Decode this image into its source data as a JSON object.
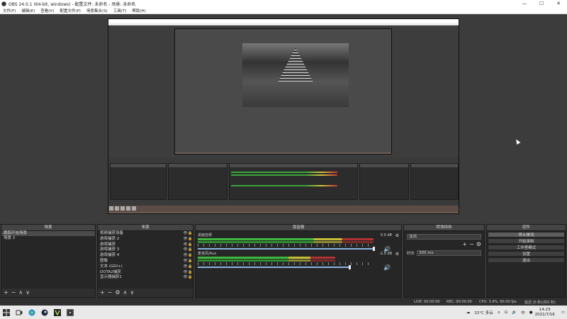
{
  "titlebar": {
    "title": "OBS 24.0.1 (64-bit, windows) - 配置文件: 未命名 - 场景: 未命名",
    "minimize": "—",
    "maximize": "☐",
    "close": "✕"
  },
  "menu": {
    "items": [
      "文件(F)",
      "编辑(E)",
      "查看(V)",
      "配置文件(P)",
      "场景集合(S)",
      "工具(T)",
      "帮助(H)"
    ]
  },
  "scenes": {
    "title": "场景",
    "items": [
      "跟踪开始场景",
      "场景 2"
    ],
    "selected_index": 0,
    "footer": [
      "+",
      "−",
      "∧",
      "∨"
    ]
  },
  "sources": {
    "title": "来源",
    "items": [
      "视频捕获设备",
      "游戏捕获 2",
      "游戏捕获",
      "游戏捕获 3",
      "游戏捕获 4",
      "图像",
      "文本 (GDI+)",
      "DOTA2捕获",
      "显示器捕获1"
    ],
    "footer": [
      "+",
      "−",
      "⚙",
      "∧",
      "∨"
    ]
  },
  "mixer": {
    "title": "混音器",
    "tracks": [
      {
        "name": "桌面音频",
        "db": "0.0 dB"
      },
      {
        "name": "麦克风/Aux",
        "db": "-2.0 dB"
      }
    ]
  },
  "transitions": {
    "title": "转场特效",
    "selected": "淡出",
    "duration_label": "时长",
    "duration_value": "300 ms"
  },
  "controls": {
    "title": "控件",
    "buttons": [
      "停止推流",
      "开始录制",
      "工作室模式",
      "设置",
      "退出"
    ]
  },
  "status": {
    "live": "LIVE: 00:00:00",
    "rec": "REC: 00:00:00",
    "cpu": "CPU: 3.4%, 60.00 fps",
    "delay": "延迟 (0 秒)(共0 秒)"
  },
  "taskbar": {
    "weather": "32°C 多云",
    "time": "14:23",
    "date": "2021/7/16"
  },
  "colors": {
    "window_bg": "#3a3a3a",
    "dock_bg": "#2b2b2b",
    "meter_green": "#3fb83f",
    "meter_yellow": "#c9c03a",
    "meter_red": "#b03232",
    "capture_frame": "#6b5d55"
  }
}
